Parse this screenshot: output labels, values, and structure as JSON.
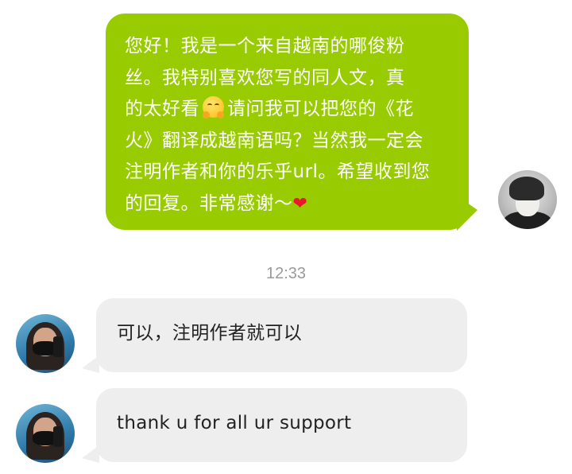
{
  "messages": [
    {
      "direction": "outgoing",
      "lines": [
        "您好！我是一个来自越南的哪俊粉",
        "丝。我特别喜欢您写的同人文，真",
        "的太好看",
        "请问我可以把您的《花",
        "火》翻译成越南语吗？当然我一定会",
        "注明作者和你的乐乎url。希望收到您",
        "的回复。非常感谢～"
      ],
      "emoji": "hugging-face-emoji",
      "trailing_emoji": "red-heart-emoji"
    },
    {
      "direction": "incoming",
      "text": "可以，注明作者就可以"
    },
    {
      "direction": "incoming",
      "text": "thank u for all ur support"
    }
  ],
  "timestamp": "12:33",
  "colors": {
    "outgoing_bubble": "#99cc00",
    "incoming_bubble": "#eeeeee",
    "timestamp": "#9a9a9a",
    "heart": "#e8192c"
  }
}
